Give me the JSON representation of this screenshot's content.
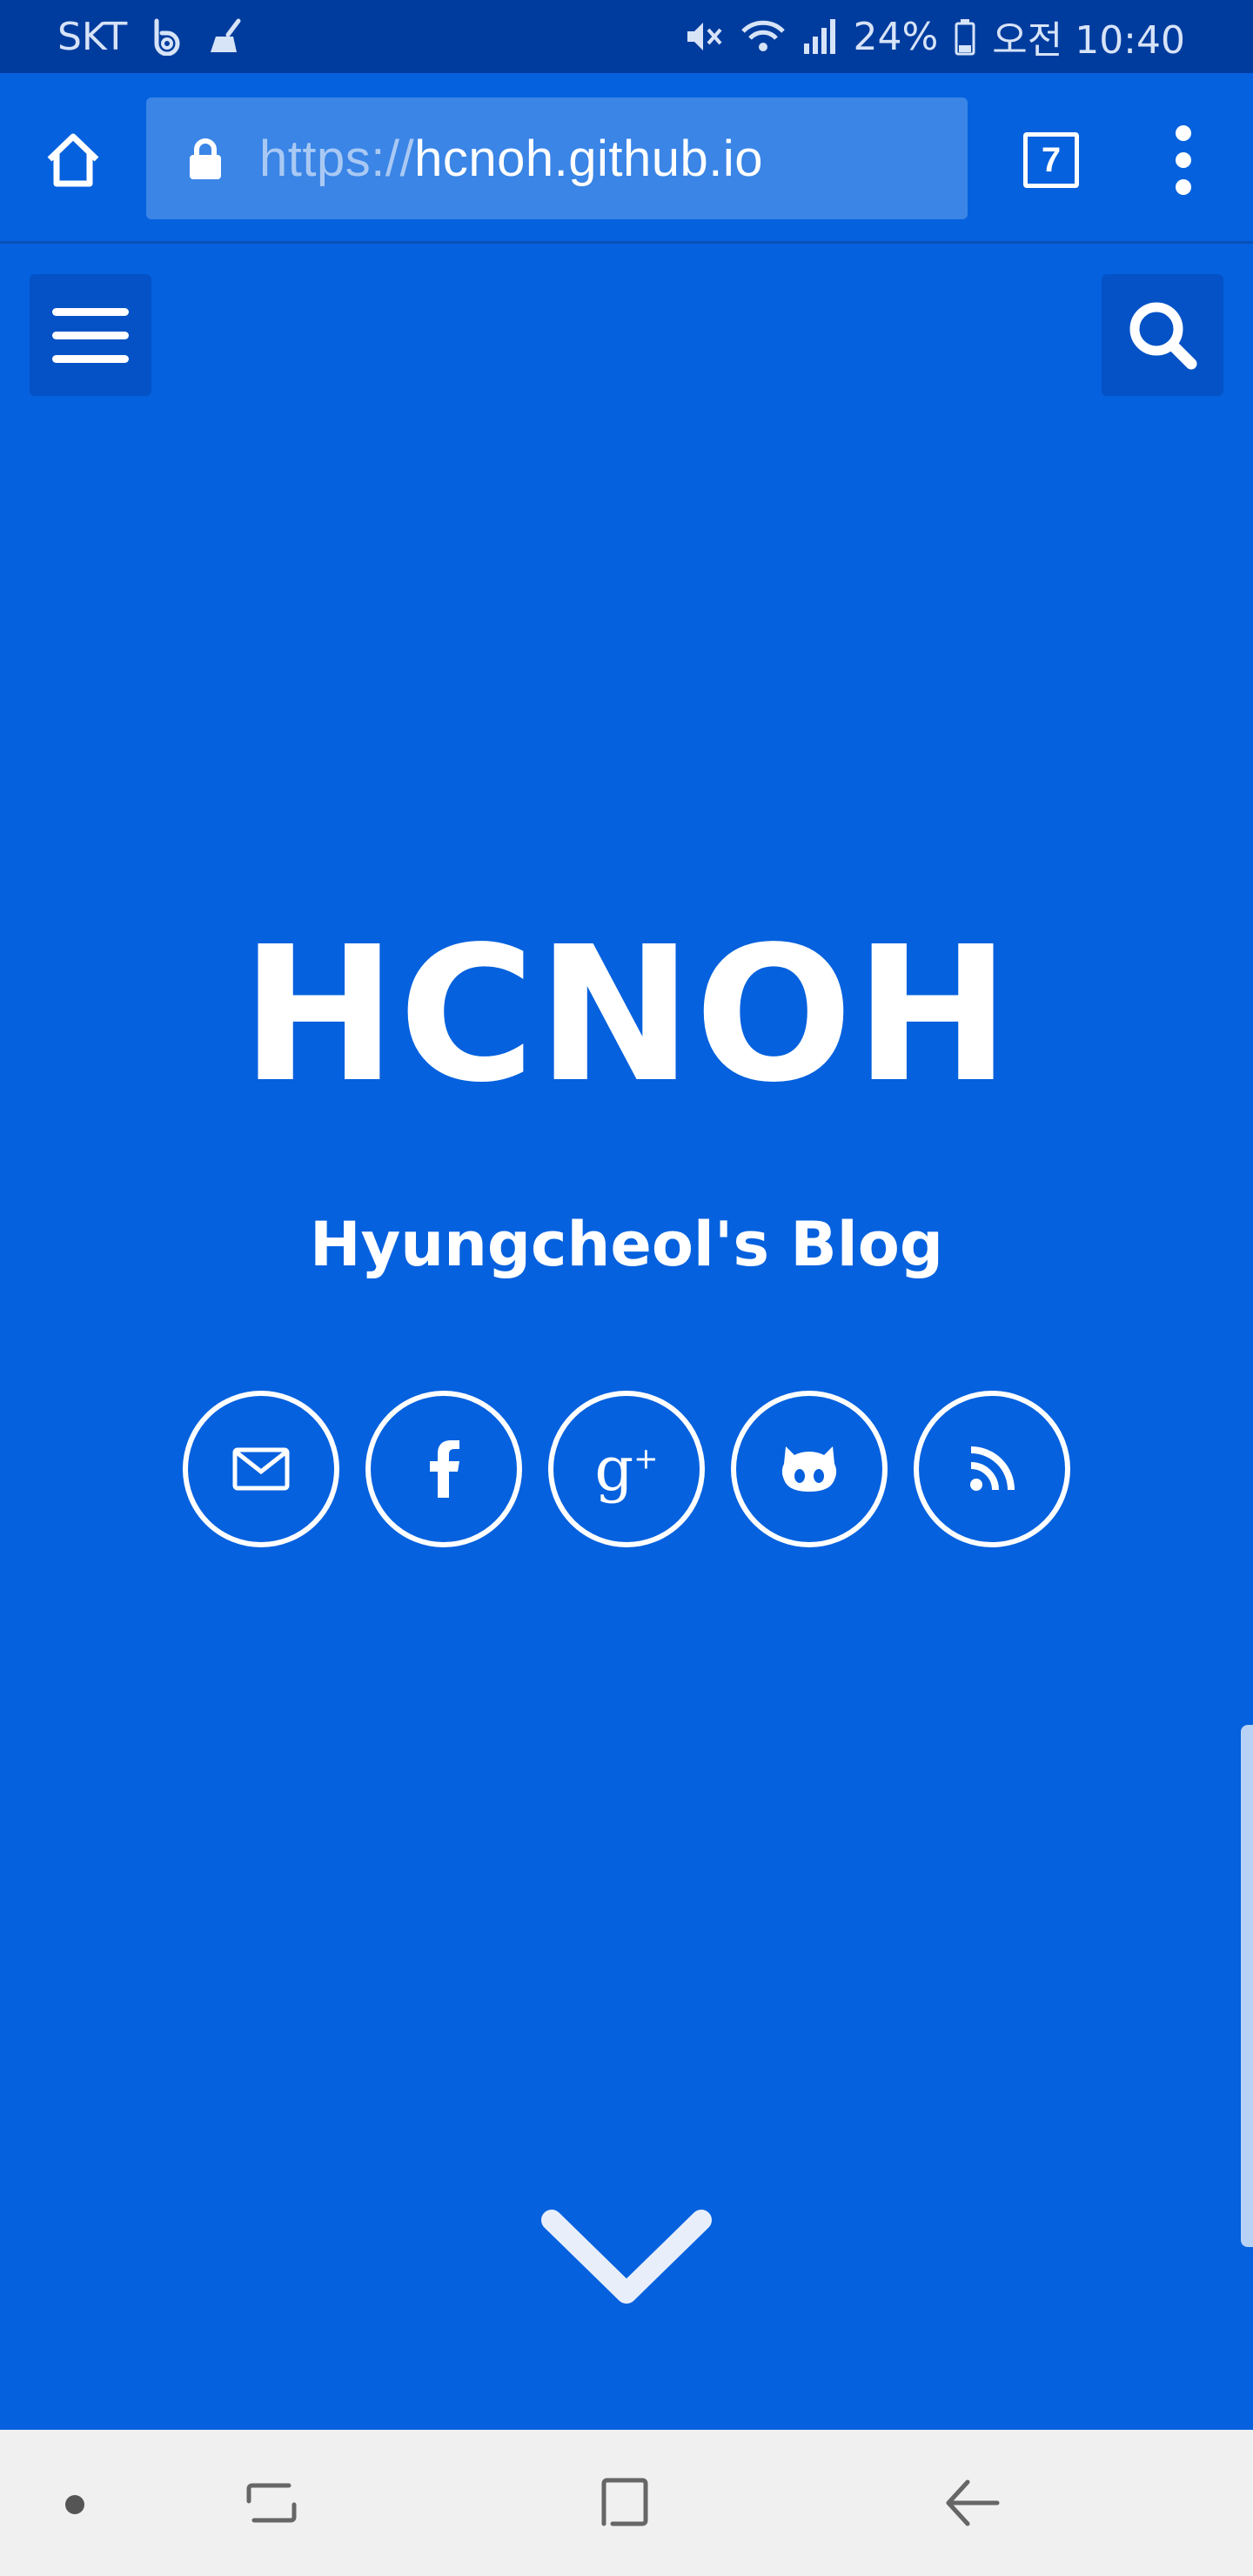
{
  "status_bar": {
    "carrier": "SKT",
    "battery": "24%",
    "time": "오전 10:40"
  },
  "browser": {
    "url_scheme": "https://",
    "url_host": "hcnoh.github.io",
    "tab_count": "7"
  },
  "hero": {
    "title": "HCNOH",
    "subtitle": "Hyungcheol's Blog"
  },
  "social_links": [
    {
      "icon": "envelope-icon"
    },
    {
      "icon": "facebook-icon"
    },
    {
      "icon": "google-plus-icon",
      "label": "g",
      "sup": "+"
    },
    {
      "icon": "github-icon"
    },
    {
      "icon": "rss-icon"
    }
  ],
  "colors": {
    "page_background": "#0561de",
    "status_bar": "#003c9e",
    "url_bar": "#3a85e6",
    "nav_bar": "#f0f0f0"
  }
}
